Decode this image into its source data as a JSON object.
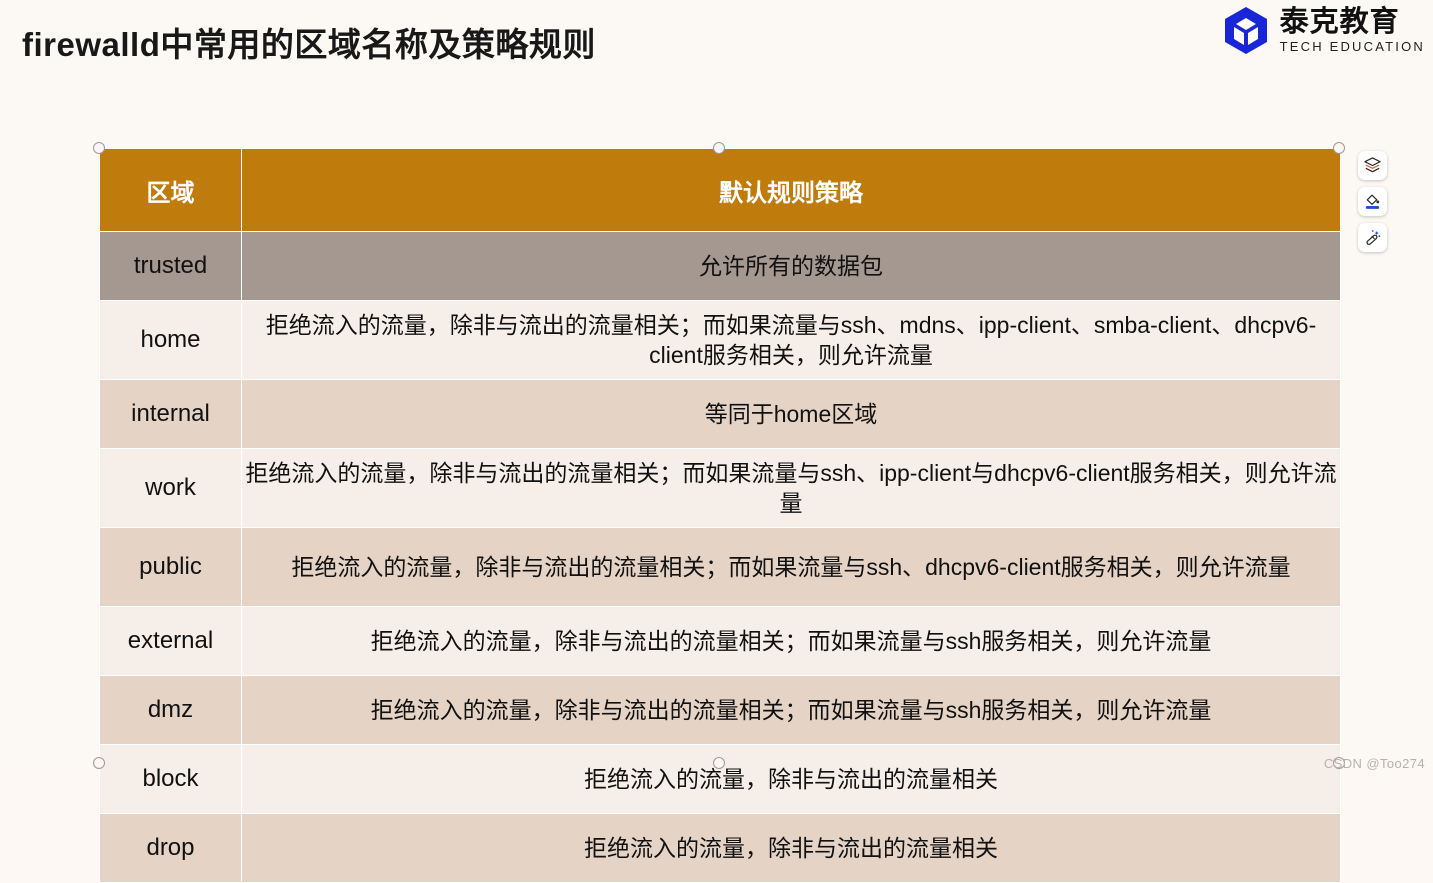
{
  "slide": {
    "title": "firewalld中常用的区域名称及策略规则",
    "background_color": "#FCF8F4"
  },
  "brand": {
    "logo_icon": "hexagon-cube-icon",
    "name_cn": "泰克教育",
    "name_en": "TECH EDUCATION",
    "mark_color": "#1826D8"
  },
  "table": {
    "header_color": "#BF7B0C",
    "columns": [
      "区域",
      "默认规则策略"
    ],
    "rows": [
      {
        "zone": "trusted",
        "rule": "允许所有的数据包",
        "shade": "trusted"
      },
      {
        "zone": "home",
        "rule": "拒绝流入的流量，除非与流出的流量相关；而如果流量与ssh、mdns、ipp-client、smba-client、dhcpv6-client服务相关，则允许流量",
        "shade": "light"
      },
      {
        "zone": "internal",
        "rule": "等同于home区域",
        "shade": "dark"
      },
      {
        "zone": "work",
        "rule": "拒绝流入的流量，除非与流出的流量相关；而如果流量与ssh、ipp-client与dhcpv6-client服务相关，则允许流量",
        "shade": "light"
      },
      {
        "zone": "public",
        "rule": "拒绝流入的流量，除非与流出的流量相关；而如果流量与ssh、dhcpv6-client服务相关，则允许流量",
        "shade": "dark"
      },
      {
        "zone": "external",
        "rule": "拒绝流入的流量，除非与流出的流量相关；而如果流量与ssh服务相关，则允许流量",
        "shade": "light"
      },
      {
        "zone": "dmz",
        "rule": "拒绝流入的流量，除非与流出的流量相关；而如果流量与ssh服务相关，则允许流量",
        "shade": "dark"
      },
      {
        "zone": "block",
        "rule": "拒绝流入的流量，除非与流出的流量相关",
        "shade": "light"
      },
      {
        "zone": "drop",
        "rule": "拒绝流入的流量，除非与流出的流量相关",
        "shade": "dark"
      }
    ]
  },
  "tools": [
    {
      "icon": "layers-icon",
      "label": "图层"
    },
    {
      "icon": "paint-bucket-icon",
      "label": "填充"
    },
    {
      "icon": "magic-wand-icon",
      "label": "魔棒"
    }
  ],
  "watermark": {
    "text": "CSDN @Too274"
  }
}
